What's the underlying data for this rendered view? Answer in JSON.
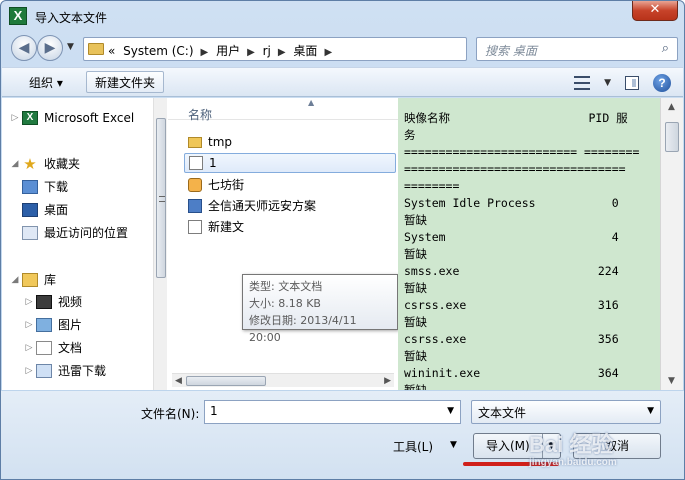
{
  "window": {
    "title": "导入文本文件",
    "close_glyph": "✕"
  },
  "navigation": {
    "address_path": [
      "«",
      "System (C:)",
      "用户",
      "rj",
      "桌面"
    ],
    "search_placeholder": "搜索 桌面"
  },
  "toolbar": {
    "organize_label": "组织 ▾",
    "new_folder_label": "新建文件夹"
  },
  "nav_pane": {
    "items": [
      {
        "label": "Microsoft Excel"
      },
      {
        "label": "收藏夹"
      },
      {
        "label": "下载"
      },
      {
        "label": "桌面"
      },
      {
        "label": "最近访问的位置"
      },
      {
        "label": "库"
      },
      {
        "label": "视频"
      },
      {
        "label": "图片"
      },
      {
        "label": "文档"
      },
      {
        "label": "迅雷下载"
      }
    ]
  },
  "file_list": {
    "column_name": "名称",
    "files": [
      {
        "name": "tmp",
        "type": "folder"
      },
      {
        "name": "1",
        "type": "text",
        "selected": true
      },
      {
        "name": "七坊街",
        "type": "shortcut"
      },
      {
        "name": "全信通天师远安方案",
        "type": "shortcut"
      },
      {
        "name": "新建文",
        "type": "text"
      }
    ]
  },
  "tooltip": {
    "line1": "类型: 文本文档",
    "line2": "大小: 8.18 KB",
    "line3": "修改日期: 2013/4/11 20:00"
  },
  "preview": {
    "text": "映像名称                    PID 服\n务\n========================= ========\n================================\n========\nSystem Idle Process           0\n暂缺\nSystem                        4\n暂缺\nsmss.exe                    224\n暂缺\ncsrss.exe                   316\n暂缺\ncsrss.exe                   356\n暂缺\nwininit.exe                 364\n暂缺"
  },
  "bottom": {
    "filename_label": "文件名(N):",
    "filename_value": "1",
    "filetype_value": "文本文件",
    "tools_label": "工具(L)",
    "import_label": "导入(M)",
    "cancel_label": "取消"
  },
  "watermark": {
    "main": "Bai 经验",
    "sub": "jingyan.baidu.com"
  },
  "colors": {
    "preview_bg": "#cfe7cf",
    "accent_red": "#d0201a",
    "close_red": "#c7432a"
  }
}
